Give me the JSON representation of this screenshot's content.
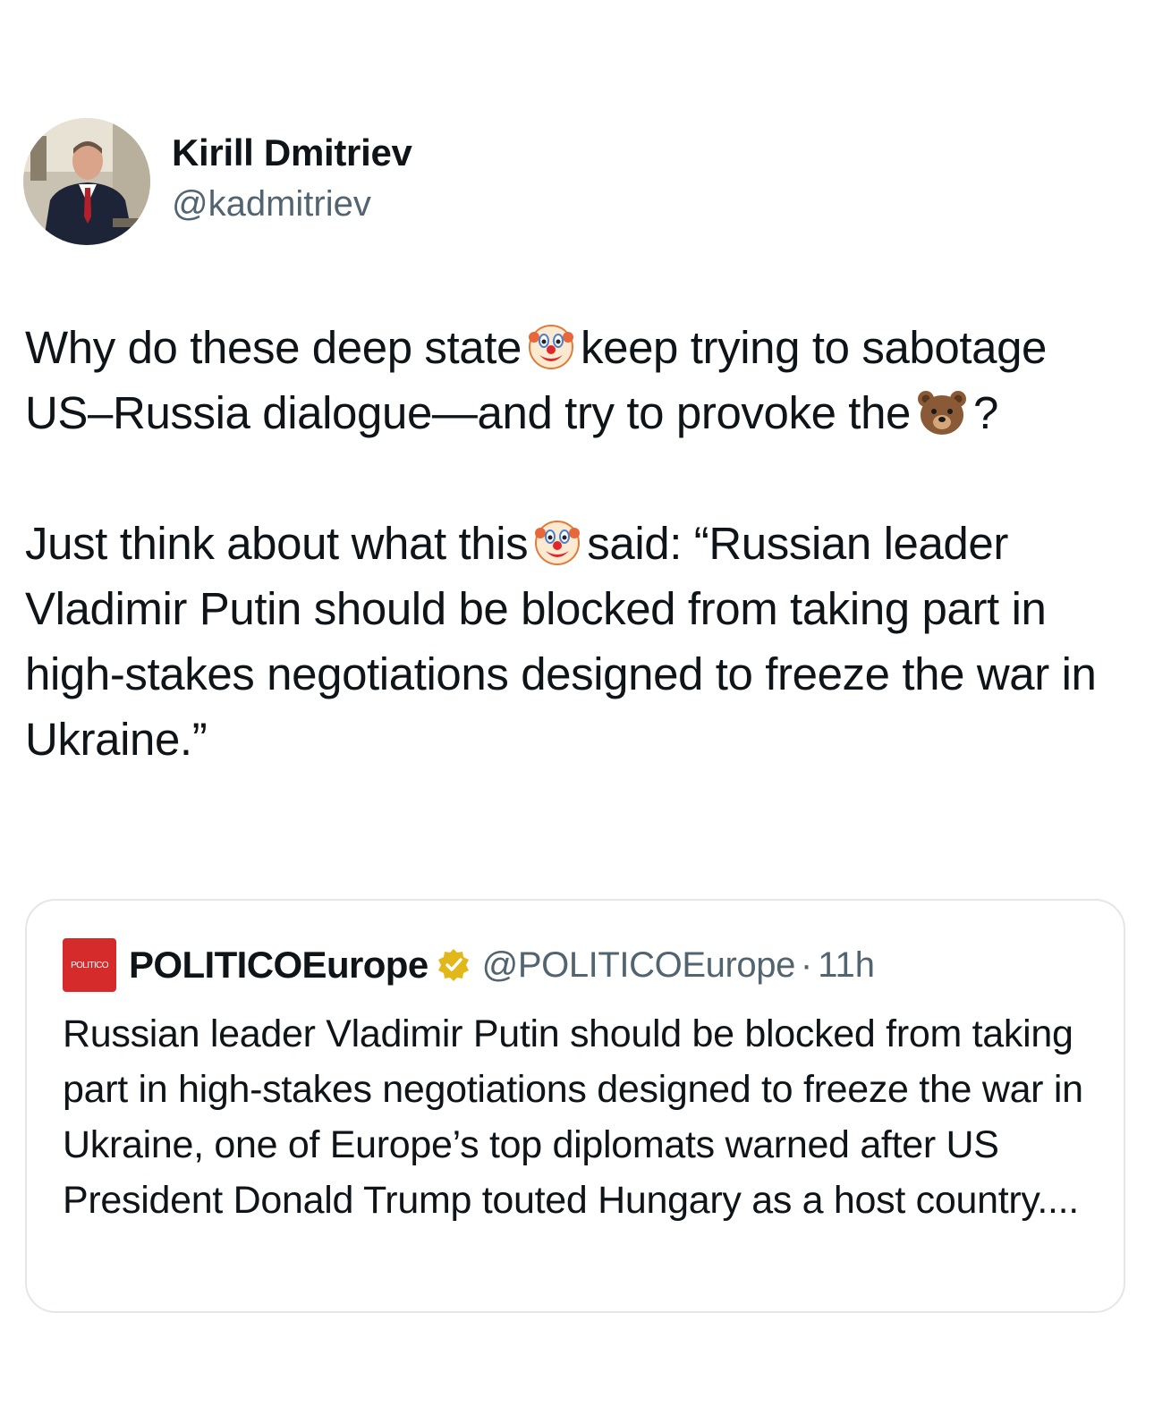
{
  "author": {
    "display_name": "Kirill Dmitriev",
    "handle": "@kadmitriev",
    "avatar_icon": "profile-photo"
  },
  "tweet": {
    "p1_a": "Why do these deep state",
    "p1_b": "keep trying to sabotage US–Russia dialogue—and try to provoke the",
    "p1_c": "?",
    "p2_a": "Just think about what this",
    "p2_b": "said: “Russian leader Vladimir Putin should be blocked from taking part in high-stakes negotiations designed to freeze the war in Ukraine.”",
    "emojis": [
      "clown-face-emoji",
      "bear-face-emoji"
    ]
  },
  "quoted_tweet": {
    "logo_text": "POLITICO",
    "name": "POLITICOEurope",
    "handle": "@POLITICOEurope",
    "separator": "·",
    "time": "11h",
    "text": "Russian leader Vladimir Putin should be blocked from taking part in high-stakes negotiations designed to freeze the war in Ukraine, one of Europe’s top diplomats warned after US President Donald Trump touted Hungary as a host country....",
    "verified_badge_color": "#e2b719",
    "logo_color": "#d52b2b"
  }
}
